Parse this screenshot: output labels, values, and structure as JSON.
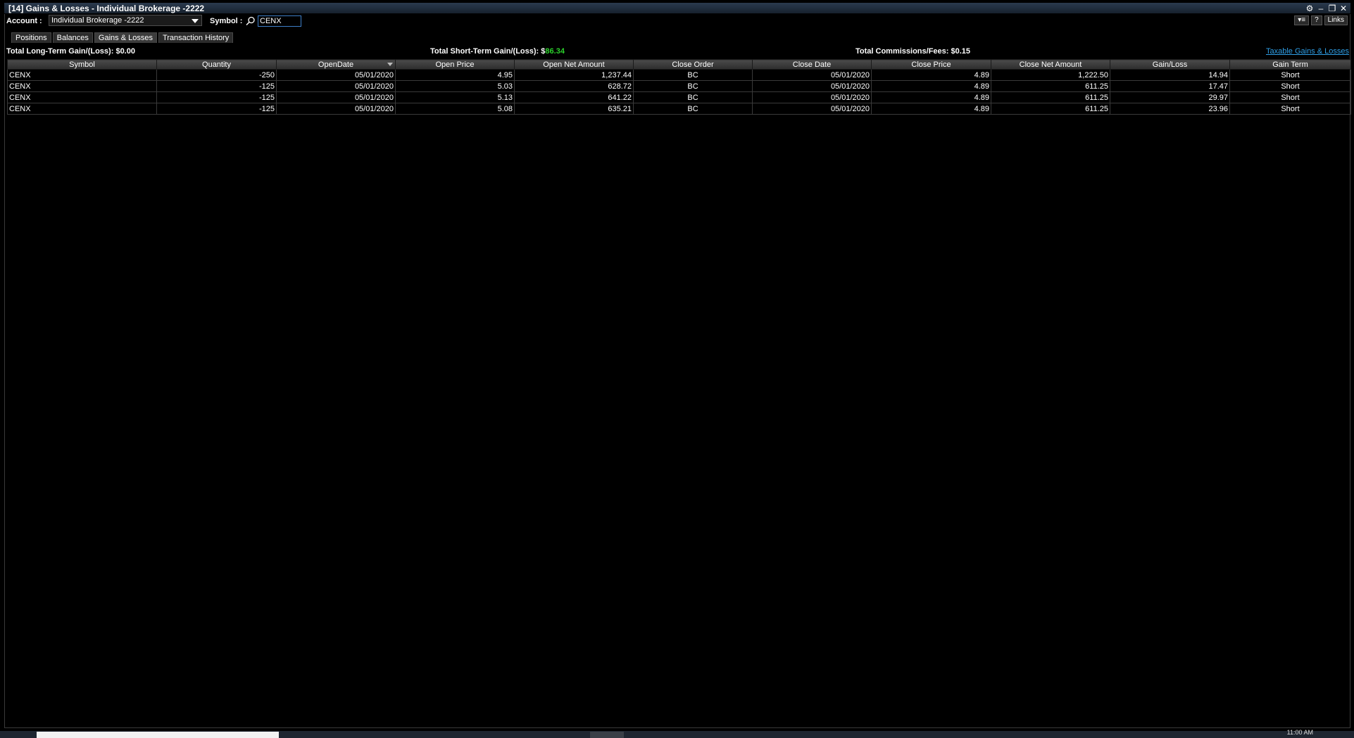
{
  "window": {
    "title": "[14] Gains & Losses - Individual Brokerage -2222"
  },
  "toolbar": {
    "account_label": "Account :",
    "account_value": "Individual Brokerage -2222",
    "symbol_label": "Symbol :",
    "symbol_value": "CENX",
    "links_label": "Links",
    "help_label": "?"
  },
  "tabs": [
    {
      "label": "Positions",
      "active": false
    },
    {
      "label": "Balances",
      "active": false
    },
    {
      "label": "Gains & Losses",
      "active": true
    },
    {
      "label": "Transaction History",
      "active": false
    }
  ],
  "totals": {
    "long_term_label": "Total Long-Term Gain/(Loss):",
    "long_term_currency": "$",
    "long_term_value": "0.00",
    "short_term_label": "Total Short-Term Gain/(Loss):",
    "short_term_currency": "$",
    "short_term_value": "86.34",
    "commissions_label": "Total Commissions/Fees:",
    "commissions_currency": "$",
    "commissions_value": "0.15",
    "taxable_link": "Taxable Gains & Losses"
  },
  "colors": {
    "positive": "#2bd22b",
    "negative": "#ff3b30",
    "link": "#2fa0e8"
  },
  "table": {
    "columns": [
      "Symbol",
      "Quantity",
      "OpenDate",
      "Open Price",
      "Open Net Amount",
      "Close Order",
      "Close Date",
      "Close Price",
      "Close Net Amount",
      "Gain/Loss",
      "Gain Term"
    ],
    "rows": [
      [
        "CENX",
        "-250",
        "05/01/2020",
        "4.95",
        "1,237.44",
        "BC",
        "05/01/2020",
        "4.89",
        "1,222.50",
        "14.94",
        "Short"
      ],
      [
        "CENX",
        "-125",
        "05/01/2020",
        "5.03",
        "628.72",
        "BC",
        "05/01/2020",
        "4.89",
        "611.25",
        "17.47",
        "Short"
      ],
      [
        "CENX",
        "-125",
        "05/01/2020",
        "5.13",
        "641.22",
        "BC",
        "05/01/2020",
        "4.89",
        "611.25",
        "29.97",
        "Short"
      ],
      [
        "CENX",
        "-125",
        "05/01/2020",
        "5.08",
        "635.21",
        "BC",
        "05/01/2020",
        "4.89",
        "611.25",
        "23.96",
        "Short"
      ]
    ]
  },
  "taskbar": {
    "clock": "11:00 AM"
  }
}
